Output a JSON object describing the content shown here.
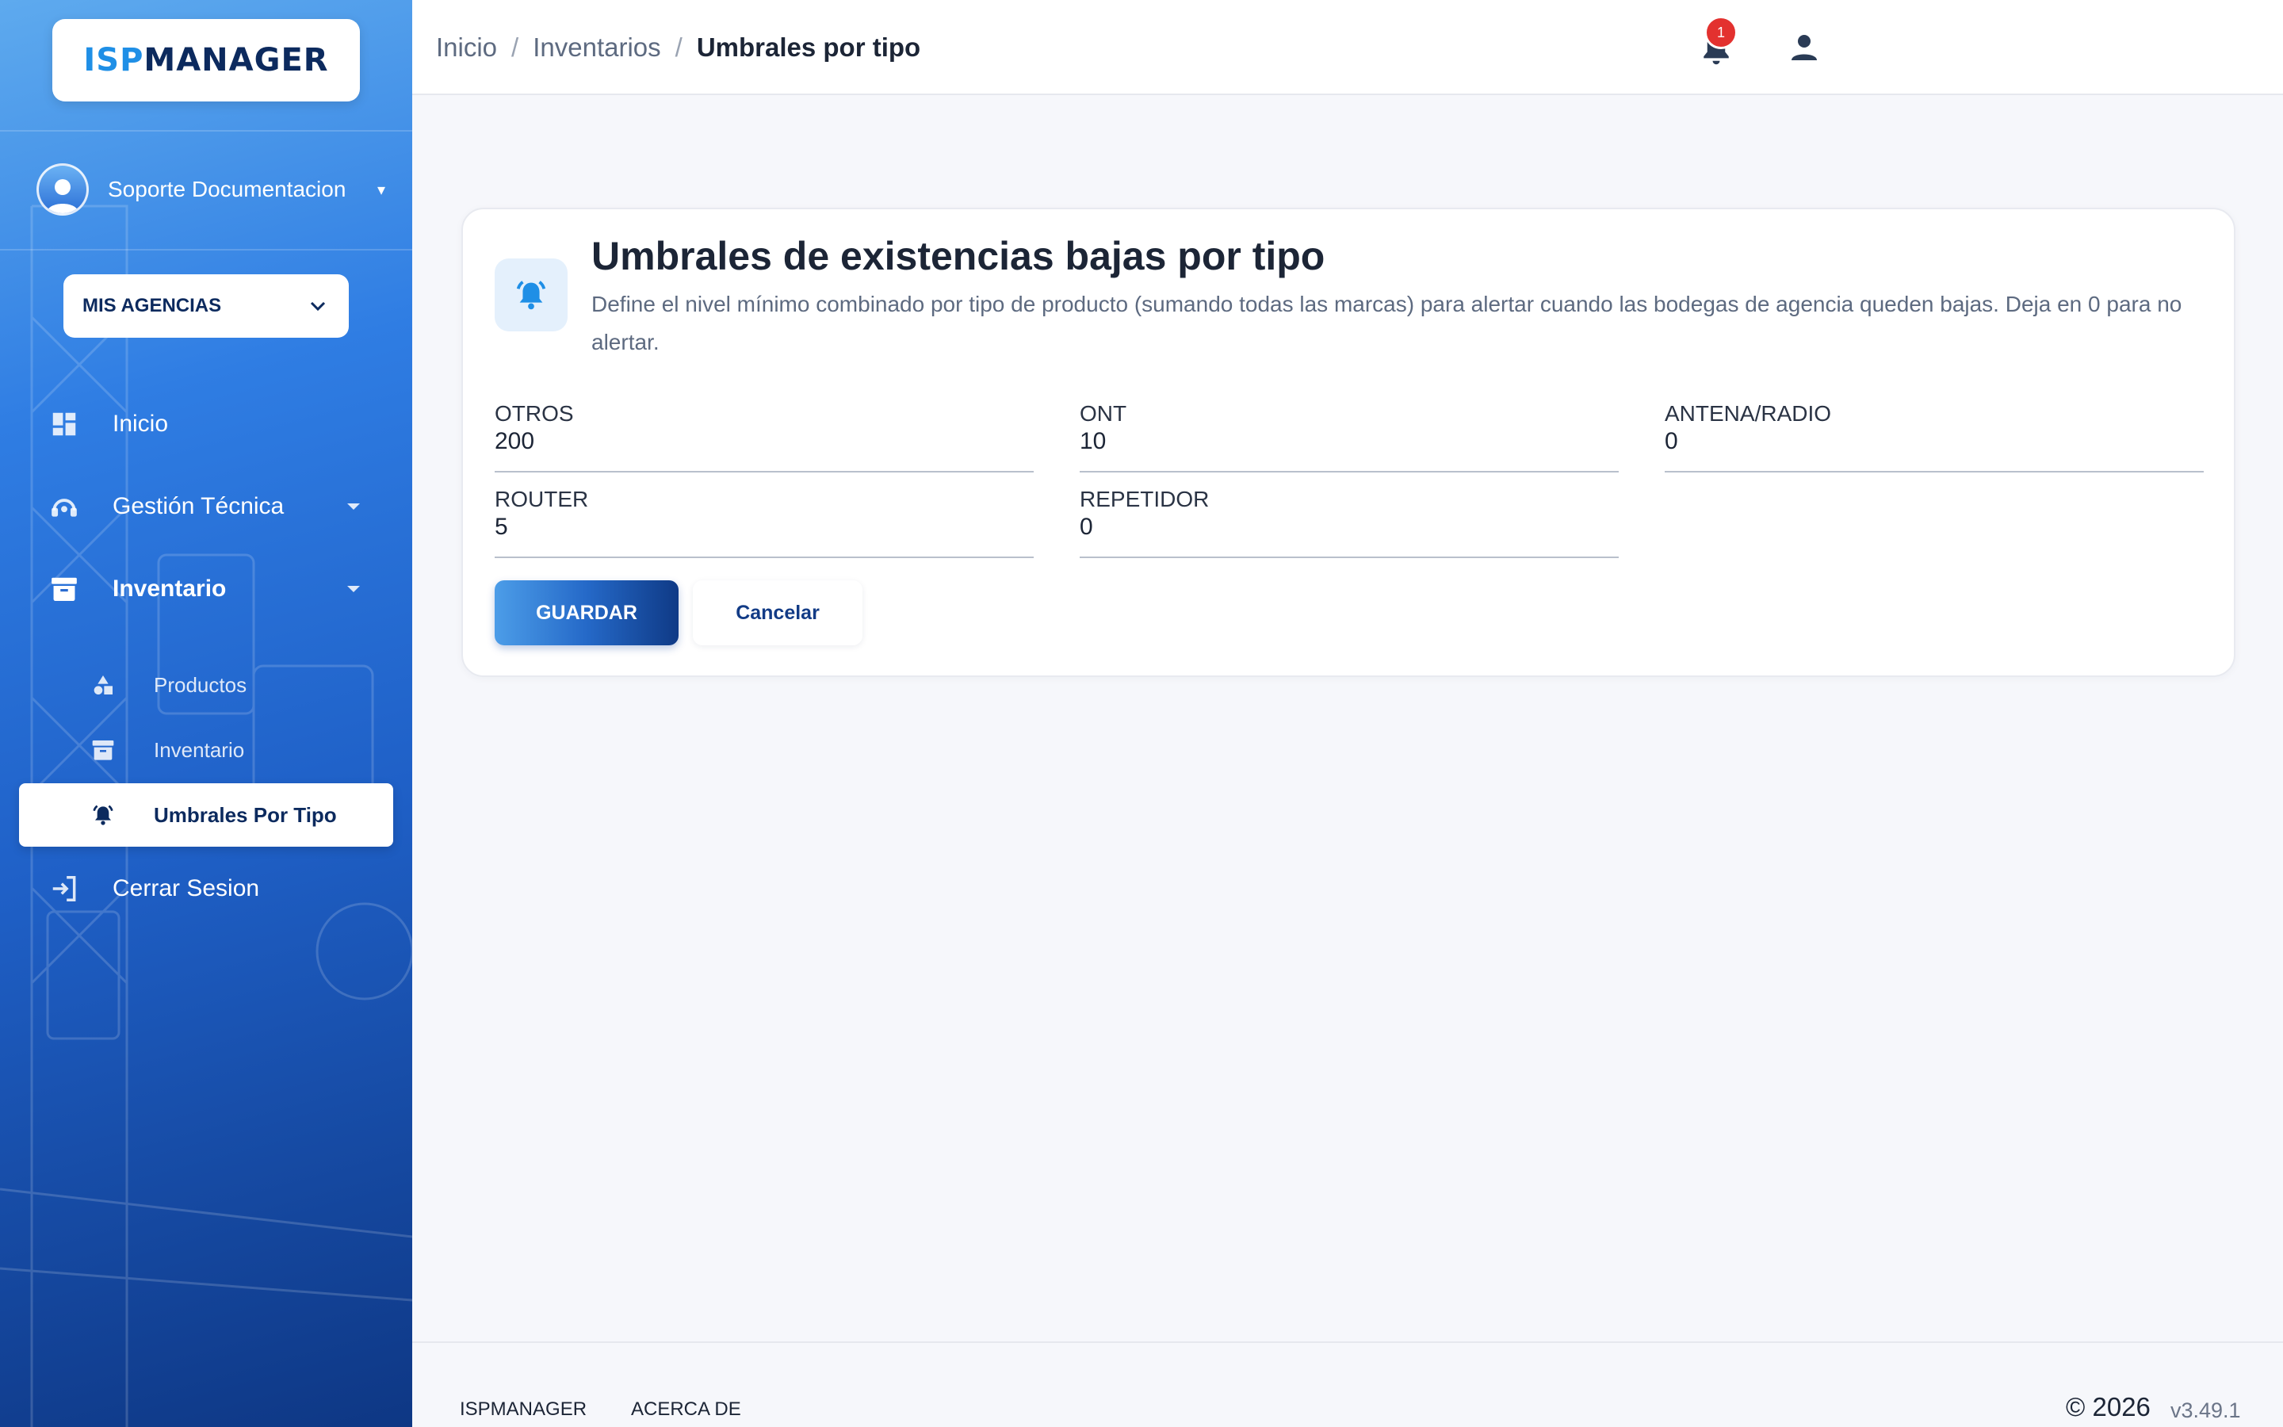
{
  "app": {
    "logo_part1": "ISP",
    "logo_part2": "MANAGER",
    "colors": {
      "primary_dark": "#0c2a5e",
      "accent": "#1f8fe6",
      "badge_red": "#e3312f"
    }
  },
  "sidebar": {
    "user_name": "Soporte Documentacion",
    "agency_select_label": "MIS AGENCIAS",
    "nav": [
      {
        "label": "Inicio",
        "icon": "dashboard-icon"
      },
      {
        "label": "Gestión Técnica",
        "icon": "headset-icon"
      },
      {
        "label": "Inventario",
        "icon": "archive-icon"
      }
    ],
    "sub_items": [
      {
        "label": "Productos",
        "icon": "shapes-icon"
      },
      {
        "label": "Inventario",
        "icon": "archive-icon"
      },
      {
        "label": "Umbrales Por Tipo",
        "icon": "bell-alert-icon",
        "active": true
      }
    ],
    "logout_label": "Cerrar Sesion"
  },
  "topbar": {
    "breadcrumb": [
      "Inicio",
      "Inventarios",
      "Umbrales por tipo"
    ],
    "notification_count": "1"
  },
  "card": {
    "title": "Umbrales de existencias bajas por tipo",
    "description": "Define el nivel mínimo combinado por tipo de producto (sumando todas las marcas) para alertar cuando las bodegas de agencia queden bajas. Deja en 0 para no alertar.",
    "fields": [
      {
        "label": "OTROS",
        "value": "200"
      },
      {
        "label": "ONT",
        "value": "10"
      },
      {
        "label": "ANTENA/RADIO",
        "value": "0"
      },
      {
        "label": "ROUTER",
        "value": "5"
      },
      {
        "label": "REPETIDOR",
        "value": "0"
      }
    ],
    "save_label": "GUARDAR",
    "cancel_label": "Cancelar"
  },
  "footer": {
    "links": [
      "ISPMANAGER",
      "ACERCA DE"
    ],
    "copyright": "© 2026",
    "version": "v3.49.1"
  }
}
